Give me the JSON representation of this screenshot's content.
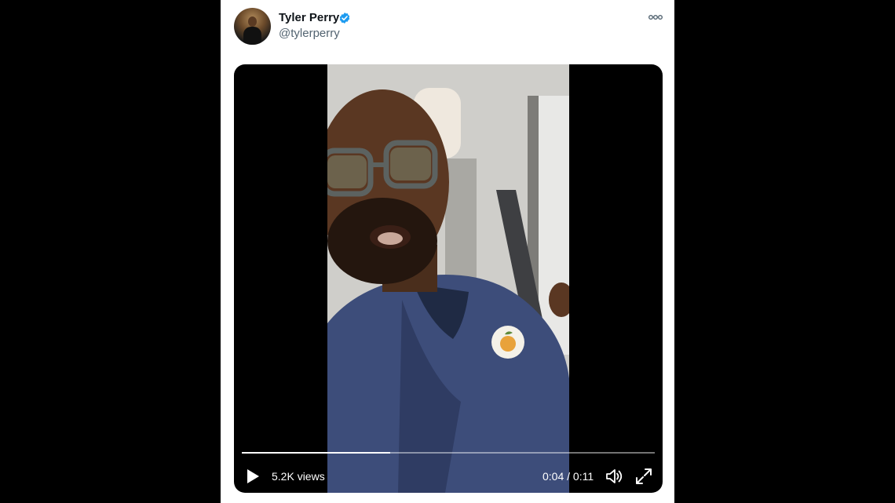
{
  "tweet": {
    "display_name": "Tyler Perry",
    "handle": "@tylerperry",
    "verified": true
  },
  "video": {
    "views_label": "5.2K views",
    "time_label": "0:04 / 0:11",
    "progress": 0.36
  },
  "colors": {
    "verified": "#1d9bf0",
    "name": "#0f1419",
    "handle": "#536471"
  },
  "icons": [
    "verified-icon",
    "more-icon",
    "play-icon",
    "volume-icon",
    "fullscreen-icon"
  ]
}
